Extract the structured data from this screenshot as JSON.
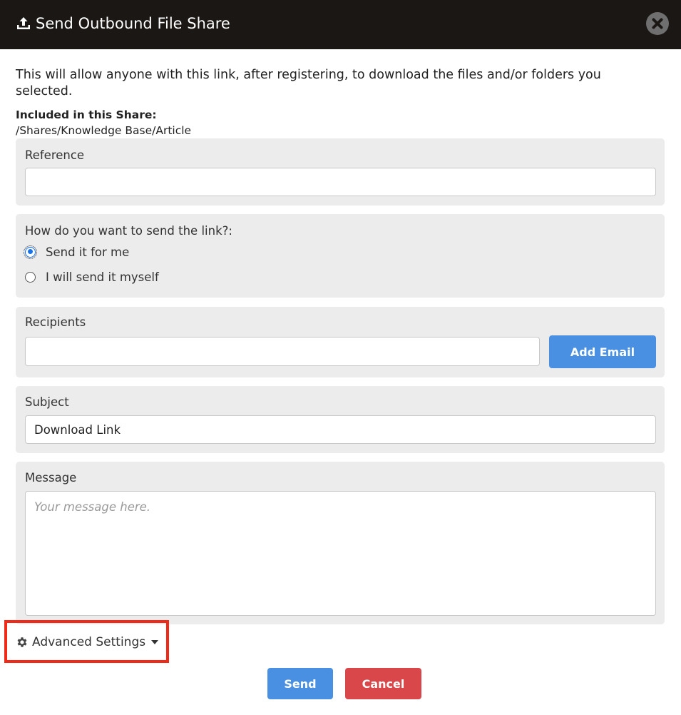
{
  "dialog": {
    "title": "Send Outbound File Share",
    "intro": "This will allow anyone with this link, after registering, to download the files and/or folders you selected.",
    "included_label": "Included in this Share:",
    "included_path": "/Shares/Knowledge Base/Article"
  },
  "reference": {
    "label": "Reference",
    "value": ""
  },
  "send_method": {
    "question": "How do you want to send the link?:",
    "options": [
      {
        "label": "Send it for me",
        "selected": true
      },
      {
        "label": "I will send it myself",
        "selected": false
      }
    ]
  },
  "recipients": {
    "label": "Recipients",
    "value": "",
    "add_button": "Add Email"
  },
  "subject": {
    "label": "Subject",
    "value": "Download Link"
  },
  "message": {
    "label": "Message",
    "placeholder": "Your message here.",
    "value": ""
  },
  "advanced": {
    "label": "Advanced Settings",
    "highlight_color": "#f02a16"
  },
  "actions": {
    "send": "Send",
    "cancel": "Cancel"
  },
  "colors": {
    "titlebar": "#1b1714",
    "primary": "#4a90e2",
    "danger": "#d9474a",
    "panel": "#ececec"
  },
  "icons": {
    "title": "upload-icon",
    "close": "close-icon",
    "advanced": "gear-icon",
    "dropdown": "caret-down-icon"
  }
}
